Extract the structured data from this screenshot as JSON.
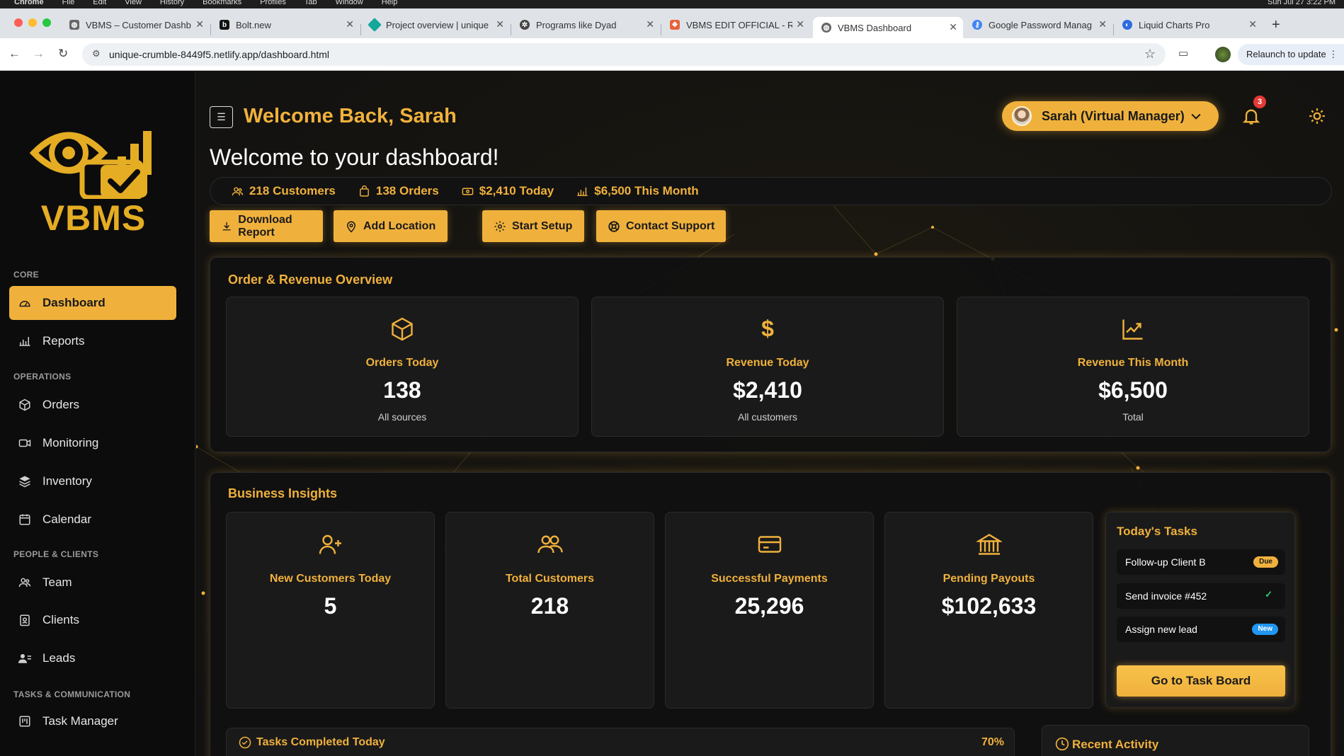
{
  "os": {
    "menu": [
      "Chrome",
      "File",
      "Edit",
      "View",
      "History",
      "Bookmarks",
      "Profiles",
      "Tab",
      "Window",
      "Help"
    ],
    "clock": "Sun Jul 27 3:22 PM"
  },
  "browser": {
    "tabs": [
      {
        "title": "VBMS – Customer Dashb",
        "favicon_color": "#555"
      },
      {
        "title": "Bolt.new",
        "favicon_color": "#111"
      },
      {
        "title": "Project overview | unique",
        "favicon_color": "#14a89c"
      },
      {
        "title": "Programs like Dyad",
        "favicon_color": "#444"
      },
      {
        "title": "VBMS EDIT OFFICIAL - R",
        "favicon_color": "#e8623a"
      },
      {
        "title": "VBMS Dashboard",
        "favicon_color": "#555"
      },
      {
        "title": "Google Password Manag",
        "favicon_color": "#4285f4"
      },
      {
        "title": "Liquid Charts Pro",
        "favicon_color": "#2d6cdf"
      }
    ],
    "active_tab_index": 5,
    "url": "unique-crumble-8449f5.netlify.app/dashboard.html",
    "relaunch_label": "Relaunch to update"
  },
  "brand": {
    "name": "VBMS",
    "accent": "#f0b13c"
  },
  "sidebar": {
    "sections": [
      {
        "label": "CORE",
        "items": [
          {
            "label": "Dashboard",
            "icon": "dashboard-icon",
            "active": true
          },
          {
            "label": "Reports",
            "icon": "bar-chart-icon"
          }
        ]
      },
      {
        "label": "OPERATIONS",
        "items": [
          {
            "label": "Orders",
            "icon": "box-icon"
          },
          {
            "label": "Monitoring",
            "icon": "camera-icon"
          },
          {
            "label": "Inventory",
            "icon": "layers-icon"
          },
          {
            "label": "Calendar",
            "icon": "calendar-icon"
          }
        ]
      },
      {
        "label": "PEOPLE & CLIENTS",
        "items": [
          {
            "label": "Team",
            "icon": "users-icon"
          },
          {
            "label": "Clients",
            "icon": "id-badge-icon"
          },
          {
            "label": "Leads",
            "icon": "user-list-icon"
          }
        ]
      },
      {
        "label": "TASKS & COMMUNICATION",
        "items": [
          {
            "label": "Task Manager",
            "icon": "kanban-icon"
          }
        ]
      }
    ]
  },
  "header": {
    "welcome": "Welcome Back, Sarah",
    "subtitle": "Welcome to your dashboard!",
    "user_name": "Sarah (Virtual Manager)",
    "notification_count": "3"
  },
  "quick_stats": [
    {
      "label": "218 Customers",
      "icon": "users-icon"
    },
    {
      "label": "138 Orders",
      "icon": "bag-icon"
    },
    {
      "label": "$2,410 Today",
      "icon": "cash-icon"
    },
    {
      "label": "$6,500 This Month",
      "icon": "bar-chart-icon"
    }
  ],
  "actions": [
    {
      "label": "Download Report",
      "icon": "download-icon"
    },
    {
      "label": "Add Location",
      "icon": "pin-icon"
    },
    {
      "label": "Start Setup",
      "icon": "gear-icon"
    },
    {
      "label": "Contact Support",
      "icon": "lifebuoy-icon"
    }
  ],
  "overview": {
    "title": "Order & Revenue Overview",
    "cards": [
      {
        "label": "Orders Today",
        "value": "138",
        "sub": "All sources",
        "icon": "box-icon"
      },
      {
        "label": "Revenue Today",
        "value": "$2,410",
        "sub": "All customers",
        "icon": "dollar-icon"
      },
      {
        "label": "Revenue This Month",
        "value": "$6,500",
        "sub": "Total",
        "icon": "trend-up-icon"
      }
    ]
  },
  "insights": {
    "title": "Business Insights",
    "cards": [
      {
        "label": "New Customers Today",
        "value": "5",
        "icon": "user-plus-icon"
      },
      {
        "label": "Total Customers",
        "value": "218",
        "icon": "users-icon"
      },
      {
        "label": "Successful Payments",
        "value": "25,296",
        "icon": "credit-card-icon"
      },
      {
        "label": "Pending Payouts",
        "value": "$102,633",
        "icon": "bank-icon"
      }
    ]
  },
  "tasks": {
    "title": "Today's Tasks",
    "items": [
      {
        "label": "Follow-up Client B",
        "tag": "Due",
        "tag_color": "#f0b13c"
      },
      {
        "label": "Send invoice #452",
        "tag": "✓",
        "tag_color": "#2ecc71"
      },
      {
        "label": "Assign new lead",
        "tag": "New",
        "tag_color": "#2196f3"
      }
    ],
    "button": "Go to Task Board"
  },
  "progress": {
    "label": "Tasks Completed Today",
    "percent": "70%"
  },
  "recent_activity": {
    "title": "Recent Activity"
  }
}
